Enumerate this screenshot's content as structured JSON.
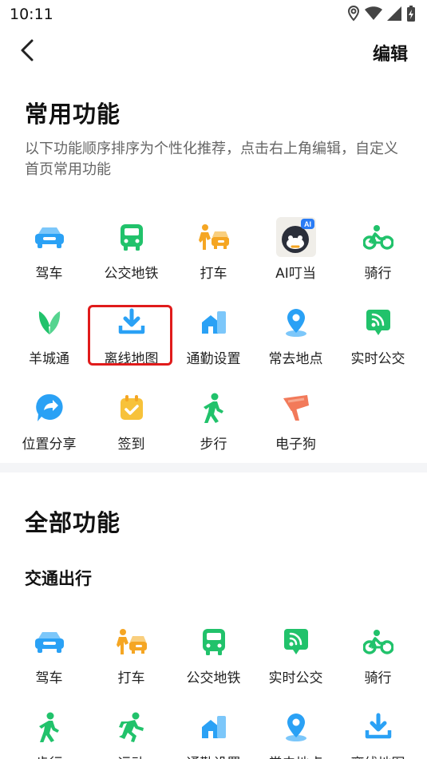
{
  "status_bar": {
    "time": "10:11",
    "icons": [
      "location-icon",
      "wifi-icon",
      "signal-icon",
      "battery-charging-icon"
    ]
  },
  "nav": {
    "back_icon": "chevron-left-icon",
    "edit_label": "编辑"
  },
  "common": {
    "title": "常用功能",
    "subtitle": "以下功能顺序排序为个性化推荐，点击右上角编辑，自定义首页常用功能",
    "items": [
      {
        "label": "驾车",
        "icon": "car-icon"
      },
      {
        "label": "公交地铁",
        "icon": "bus-icon"
      },
      {
        "label": "打车",
        "icon": "taxi-icon"
      },
      {
        "label": "AI叮当",
        "icon": "ai-mascot-icon"
      },
      {
        "label": "骑行",
        "icon": "bike-icon"
      },
      {
        "label": "羊城通",
        "icon": "yangchengtong-icon"
      },
      {
        "label": "离线地图",
        "icon": "download-icon"
      },
      {
        "label": "通勤设置",
        "icon": "commute-icon"
      },
      {
        "label": "常去地点",
        "icon": "location-pin-icon"
      },
      {
        "label": "实时公交",
        "icon": "realtime-bus-icon"
      },
      {
        "label": "位置分享",
        "icon": "share-location-icon"
      },
      {
        "label": "签到",
        "icon": "calendar-check-icon"
      },
      {
        "label": "步行",
        "icon": "walk-icon"
      },
      {
        "label": "电子狗",
        "icon": "speed-camera-icon"
      }
    ]
  },
  "all": {
    "title": "全部功能",
    "group_title": "交通出行",
    "items": [
      {
        "label": "驾车",
        "icon": "car-icon"
      },
      {
        "label": "打车",
        "icon": "taxi-icon"
      },
      {
        "label": "公交地铁",
        "icon": "bus-icon"
      },
      {
        "label": "实时公交",
        "icon": "realtime-bus-icon"
      },
      {
        "label": "骑行",
        "icon": "bike-icon"
      },
      {
        "label": "步行",
        "icon": "walk-icon"
      },
      {
        "label": "运动",
        "icon": "run-icon"
      },
      {
        "label": "通勤设置",
        "icon": "commute-icon"
      },
      {
        "label": "常去地点",
        "icon": "location-pin-icon"
      },
      {
        "label": "离线地图",
        "icon": "download-icon"
      }
    ]
  },
  "colors": {
    "blue": "#2aa1f5",
    "green": "#21c26b",
    "orange": "#f5a623",
    "yellow": "#f7c23a",
    "coral": "#f27a5a",
    "highlight": "#e01b1b"
  }
}
